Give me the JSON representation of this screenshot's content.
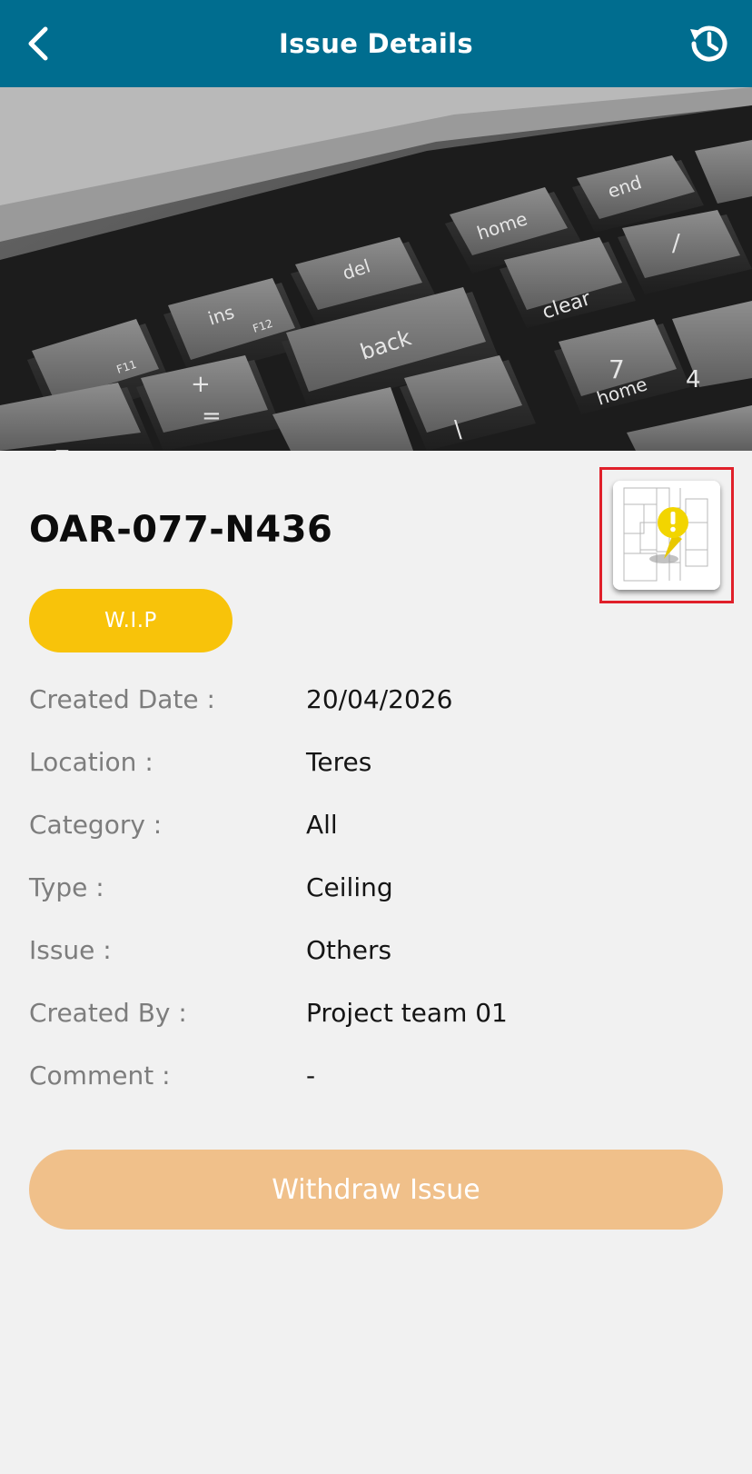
{
  "header": {
    "title": "Issue Details",
    "back_icon": "chevron-left-icon",
    "history_icon": "history-icon",
    "background": "#006d8f"
  },
  "photo": {
    "description_icon": "keyboard-photo",
    "key_labels": [
      "home",
      "end",
      "del",
      "ins",
      "F12",
      "F11",
      "back",
      "clear",
      "7",
      "4",
      "+",
      "="
    ]
  },
  "issue": {
    "id": "OAR-077-N436",
    "status": "W.I.P",
    "status_color": "#f8c30a"
  },
  "floor_plan": {
    "icon": "floor-plan-marker-icon",
    "marker_color": "#f2d500"
  },
  "details": [
    {
      "label": "Created Date :",
      "value": "20/04/2026"
    },
    {
      "label": "Location :",
      "value": "Teres"
    },
    {
      "label": "Category :",
      "value": "All"
    },
    {
      "label": "Type :",
      "value": "Ceiling"
    },
    {
      "label": "Issue :",
      "value": "Others"
    },
    {
      "label": "Created By :",
      "value": "Project team 01"
    },
    {
      "label": "Comment :",
      "value": "-"
    }
  ],
  "actions": {
    "withdraw_label": "Withdraw Issue",
    "withdraw_color": "#f0c08a"
  }
}
